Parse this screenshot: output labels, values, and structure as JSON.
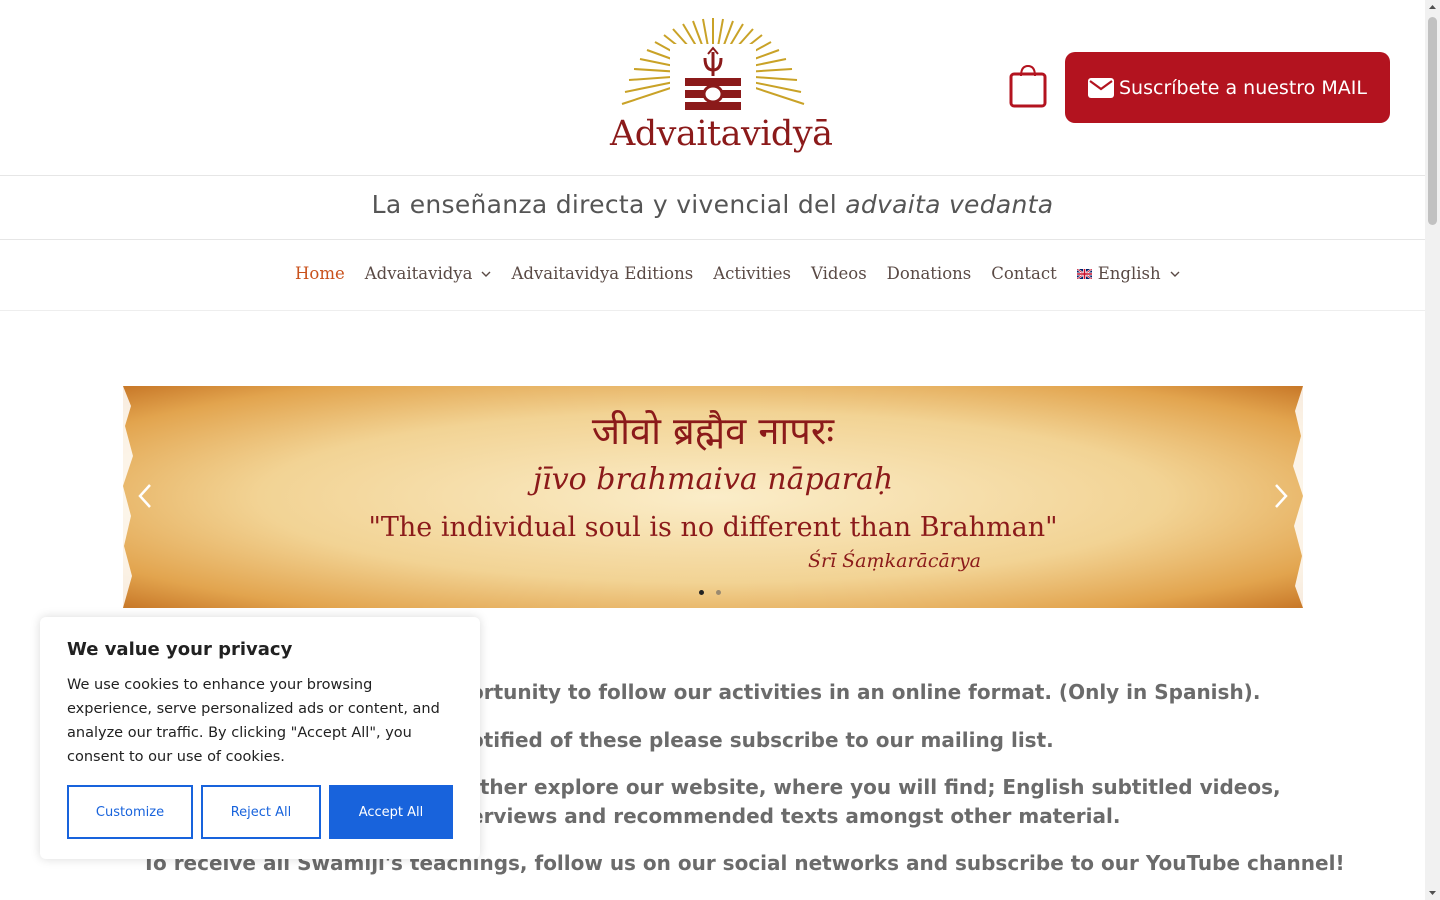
{
  "header": {
    "logo_text": "Advaitavidyā",
    "subscribe_label": "Suscríbete a nuestro MAIL",
    "tagline_main": "La enseñanza directa y vivencial del ",
    "tagline_em": "advaita vedanta"
  },
  "nav": {
    "items": [
      {
        "label": "Home",
        "active": true
      },
      {
        "label": "Advaitavidya",
        "has_dropdown": true
      },
      {
        "label": "Advaitavidya Editions"
      },
      {
        "label": "Activities"
      },
      {
        "label": "Videos"
      },
      {
        "label": "Donations"
      },
      {
        "label": "Contact"
      },
      {
        "label": "English",
        "has_dropdown": true,
        "flag": "uk-flag-icon"
      }
    ]
  },
  "slider": {
    "devanagari": "जीवो ब्रह्मैव नापरः",
    "transliteration": "jīvo brahmaiva nāparaḥ",
    "quote": "\"The individual soul is no different than Brahman\"",
    "author": "Śrī Śaṃkarācārya",
    "slide_count": 2,
    "active_slide": 1
  },
  "content": {
    "line1": "ortunity to follow our activities in an online format. (Only in Spanish).",
    "line2": "otified of these please subscribe to our mailing list.",
    "line3a": "rther explore our website, where you will find; English subtitled videos,",
    "line3b": "erviews and recommended texts amongst other material.",
    "line4": "To receive all Swamiji's teachings, follow us on our social networks and subscribe to our YouTube channel!"
  },
  "cookie": {
    "title": "We value your privacy",
    "description": "We use cookies to enhance your browsing experience, serve personalized ads or content, and analyze our traffic. By clicking \"Accept All\", you consent to our use of cookies.",
    "customize": "Customize",
    "reject": "Reject All",
    "accept": "Accept All"
  },
  "colors": {
    "brand_red": "#b3131f",
    "maroon": "#8b1a1a",
    "nav_active": "#c9521c",
    "cookie_blue": "#1863dc"
  }
}
